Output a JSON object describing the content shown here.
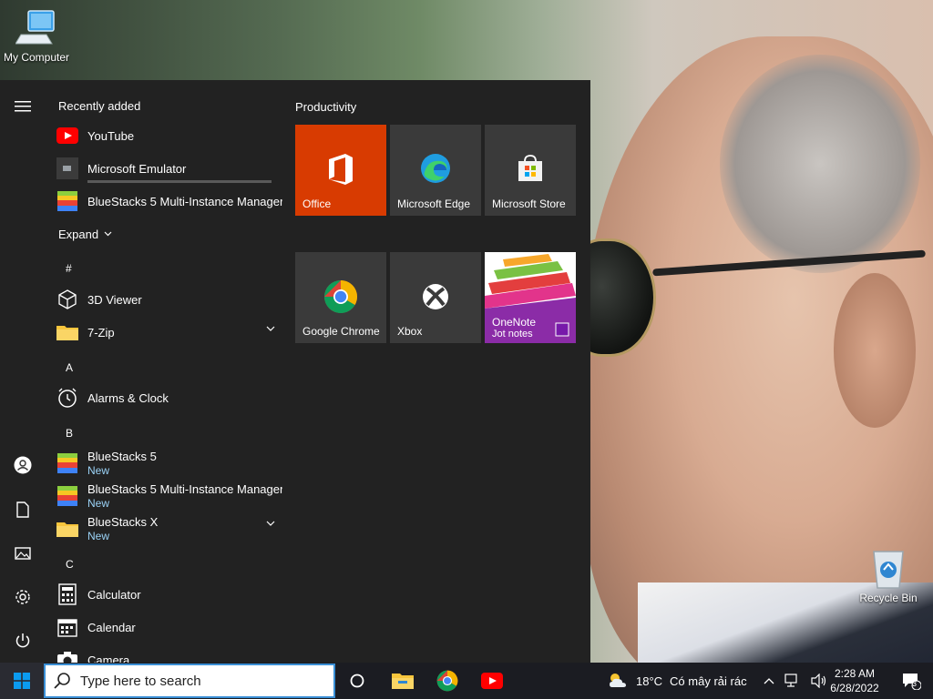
{
  "desktop": {
    "icons": [
      {
        "label": "My Computer"
      },
      {
        "label": "Recycle Bin"
      }
    ]
  },
  "start_menu": {
    "recently_added_label": "Recently added",
    "recent_apps": [
      {
        "label": "YouTube"
      },
      {
        "label": "Microsoft Emulator"
      },
      {
        "label": "BlueStacks 5 Multi-Instance Manager"
      }
    ],
    "expand_label": "Expand",
    "sections": {
      "hash": "#",
      "a": "A",
      "b": "B",
      "c": "C"
    },
    "apps": {
      "viewer3d": "3D Viewer",
      "zip7": "7-Zip",
      "alarms": "Alarms & Clock",
      "bluestacks5": "BlueStacks 5",
      "bluestacks5_sub": "New",
      "bluestacks_mim": "BlueStacks 5 Multi-Instance Manager",
      "bluestacks_mim_sub": "New",
      "bluestacksx": "BlueStacks X",
      "bluestacksx_sub": "New",
      "calculator": "Calculator",
      "calendar": "Calendar",
      "camera": "Camera"
    },
    "tiles": {
      "group_title": "Productivity",
      "office": "Office",
      "edge": "Microsoft Edge",
      "store": "Microsoft Store",
      "chrome": "Google Chrome",
      "xbox": "Xbox",
      "onenote": "OneNote",
      "onenote_sub": "Jot notes"
    },
    "colors": {
      "office_tile": "#d83b01",
      "accent": "#0078d7"
    }
  },
  "taskbar": {
    "search_placeholder": "Type here to search",
    "weather_temp": "18°C",
    "weather_text": "Có mây rải rác",
    "time": "2:28 AM",
    "date": "6/28/2022",
    "notification_count": "3"
  }
}
